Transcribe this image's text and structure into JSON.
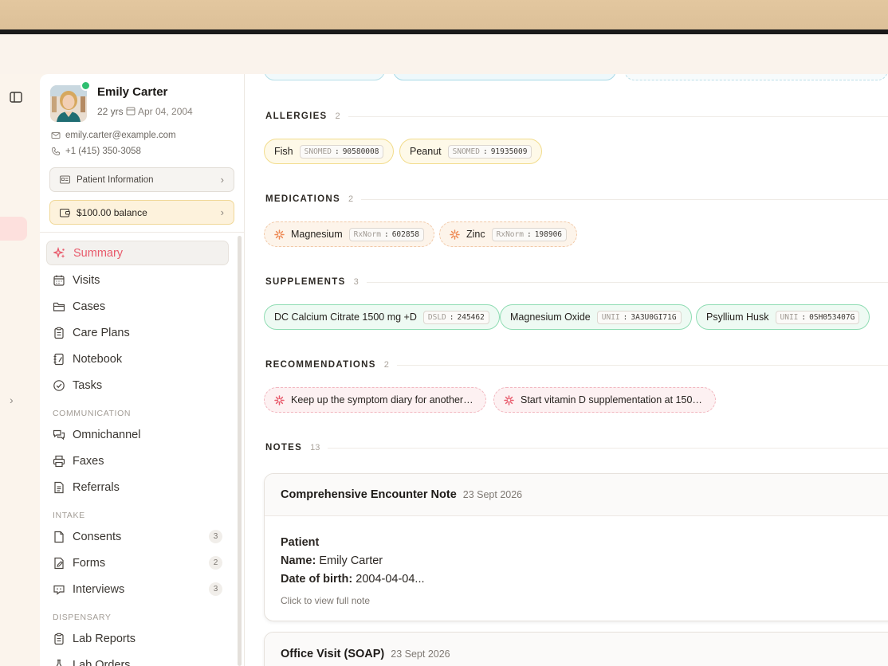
{
  "patient": {
    "name": "Emily Carter",
    "age": "22 yrs",
    "dob": "Apr 04, 2004",
    "email": "emily.carter@example.com",
    "phone": "+1 (415) 350-3058",
    "patient_info_label": "Patient Information",
    "balance_label": "$100.00 balance"
  },
  "nav": {
    "summary": "Summary",
    "visits": "Visits",
    "cases": "Cases",
    "care_plans": "Care Plans",
    "notebook": "Notebook",
    "tasks": "Tasks",
    "communication_label": "COMMUNICATION",
    "omnichannel": "Omnichannel",
    "faxes": "Faxes",
    "referrals": "Referrals",
    "intake_label": "INTAKE",
    "consents": "Consents",
    "consents_count": "3",
    "forms": "Forms",
    "forms_count": "2",
    "interviews": "Interviews",
    "interviews_count": "3",
    "dispensary_label": "DISPENSARY",
    "lab_reports": "Lab Reports",
    "lab_orders": "Lab Orders"
  },
  "sections": {
    "allergies": {
      "title": "ALLERGIES",
      "count": "2"
    },
    "medications": {
      "title": "MEDICATIONS",
      "count": "2"
    },
    "supplements": {
      "title": "SUPPLEMENTS",
      "count": "3"
    },
    "recommendations": {
      "title": "RECOMMENDATIONS",
      "count": "2"
    },
    "notes": {
      "title": "NOTES",
      "count": "13"
    }
  },
  "allergies": [
    {
      "name": "Fish",
      "system": "SNOMED",
      "code": "90580008"
    },
    {
      "name": "Peanut",
      "system": "SNOMED",
      "code": "91935009"
    }
  ],
  "medications": [
    {
      "name": "Magnesium",
      "system": "RxNorm",
      "code": "602858"
    },
    {
      "name": "Zinc",
      "system": "RxNorm",
      "code": "198906"
    }
  ],
  "supplements": [
    {
      "name": "DC Calcium Citrate 1500 mg +D",
      "system": "DSLD",
      "code": "245462"
    },
    {
      "name": "Magnesium Oxide",
      "system": "UNII",
      "code": "3A3U0GI71G"
    },
    {
      "name": "Psyllium Husk",
      "system": "UNII",
      "code": "0SH053407G"
    }
  ],
  "recommendations": [
    {
      "text": "Keep up the symptom diary for another c..."
    },
    {
      "text": "Start vitamin D supplementation at 1500 I..."
    }
  ],
  "notes": [
    {
      "title": "Comprehensive Encounter Note",
      "date": "23 Sept 2026",
      "heading": "Patient",
      "name_label": "Name:",
      "name_value": "Emily Carter",
      "dob_label": "Date of birth:",
      "dob_value": "2004-04-04...",
      "hint": "Click to view full note"
    },
    {
      "title": "Office Visit (SOAP)",
      "date": "23 Sept 2026"
    }
  ],
  "colors": {
    "accent": "#e85a6b",
    "allergy_border": "#f2dc8c",
    "supplement_border": "#8fdcb3",
    "online": "#2fbf71"
  }
}
